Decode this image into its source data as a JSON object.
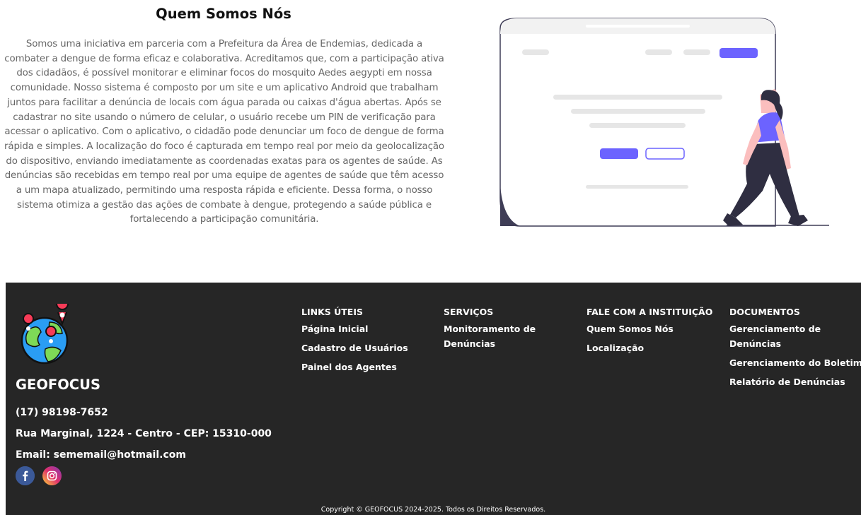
{
  "about": {
    "title": "Quem Somos Nós",
    "text": "Somos uma iniciativa em parceria com a Prefeitura da Área de Endemias, dedicada a combater a dengue de forma eficaz e colaborativa. Acreditamos que, com a participação ativa dos cidadãos, é possível monitorar e eliminar focos do mosquito Aedes aegypti em nossa comunidade. Nosso sistema é composto por um site e um aplicativo Android que trabalham juntos para facilitar a denúncia de locais com água parada ou caixas d'água abertas. Após se cadastrar no site usando o número de celular, o usuário recebe um PIN de verificação para acessar o aplicativo. Com o aplicativo, o cidadão pode denunciar um foco de dengue de forma rápida e simples. A localização do foco é capturada em tempo real por meio da geolocalização do dispositivo, enviando imediatamente as coordenadas exatas para os agentes de saúde. As denúncias são recebidas em tempo real por uma equipe de agentes de saúde que têm acesso a um mapa atualizado, permitindo uma resposta rápida e eficiente. Dessa forma, o nosso sistema otimiza a gestão das ações de combate à dengue, protegendo a saúde pública e fortalecendo a participação comunitária.",
    "illustration_accent": "#6c63ff"
  },
  "footer": {
    "brand": "GEOFOCUS",
    "phone": "(17) 98198-7652",
    "address": "Rua Marginal, 1224 - Centro - CEP: 15310-000",
    "email": "Email: sememail@hotmail.com",
    "background": "#262626",
    "columns": [
      {
        "title": "LINKS ÚTEIS",
        "links": [
          "Página Inicial",
          "Cadastro de Usuários",
          "Painel dos Agentes"
        ]
      },
      {
        "title": "SERVIÇOS",
        "links": [
          "Monitoramento de Denúncias"
        ]
      },
      {
        "title": "FALE COM A INSTITUIÇÃO",
        "links": [
          "Quem Somos Nós",
          "Localização"
        ]
      },
      {
        "title": "DOCUMENTOS",
        "links": [
          "Gerenciamento de Denúncias",
          "Gerenciamento do Boletim",
          "Relatório de Denúncias"
        ]
      }
    ],
    "socials": [
      {
        "icon": "facebook-icon",
        "color": "#3b5998"
      },
      {
        "icon": "instagram-icon",
        "color": "#e1306c"
      }
    ],
    "copyright": "Copyright © GEOFOCUS 2024-2025. Todos os Direitos Reservados."
  }
}
